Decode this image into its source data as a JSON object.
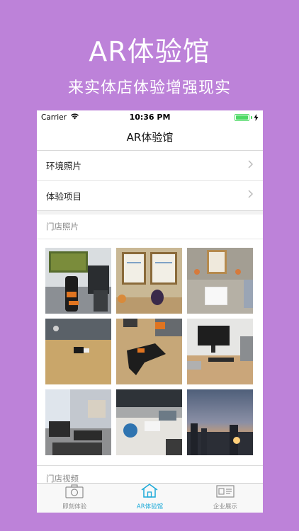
{
  "promo": {
    "title": "AR体验馆",
    "subtitle": "来实体店体验增强现实"
  },
  "status_bar": {
    "carrier": "Carrier",
    "time": "10:36 PM",
    "battery_icon": "battery-full-icon",
    "wifi_icon": "wifi-icon"
  },
  "nav": {
    "title": "AR体验馆"
  },
  "menu": {
    "items": [
      {
        "label": "环境照片",
        "icon": "chevron-right-icon"
      },
      {
        "label": "体验项目",
        "icon": "chevron-right-icon"
      }
    ]
  },
  "store_photos": {
    "header": "门店照片",
    "photos": [
      {
        "name": "vr-racing-seat"
      },
      {
        "name": "certificates-wall"
      },
      {
        "name": "certificate-and-tablet"
      },
      {
        "name": "phone-on-desk"
      },
      {
        "name": "vr-controller"
      },
      {
        "name": "office-desk-monitor"
      },
      {
        "name": "lounge-sofas"
      },
      {
        "name": "desk-globe"
      },
      {
        "name": "city-sunset"
      }
    ]
  },
  "store_videos": {
    "header": "门店视频"
  },
  "tabs": [
    {
      "label": "即刻体验",
      "icon": "camera-icon",
      "active": false
    },
    {
      "label": "AR体验馆",
      "icon": "home-icon",
      "active": true
    },
    {
      "label": "企业展示",
      "icon": "id-card-icon",
      "active": false
    }
  ],
  "colors": {
    "background": "#bd82d9",
    "tab_active": "#1ba9d8",
    "battery": "#4cd964"
  }
}
